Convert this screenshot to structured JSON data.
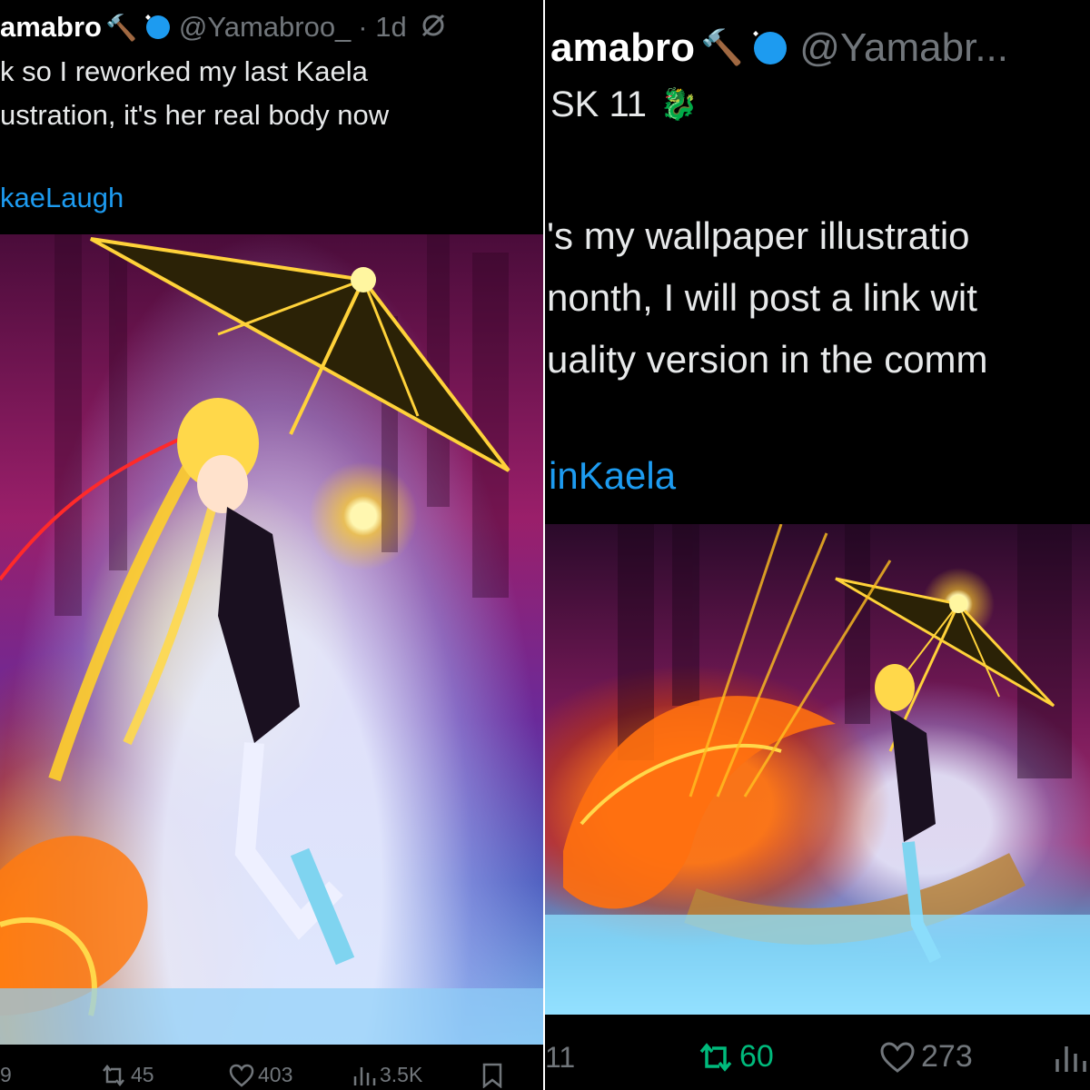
{
  "left": {
    "name": "amabro",
    "emoji": "🔨",
    "handle": "@Yamabroo_",
    "time": "· 1d",
    "text_lines": [
      "k so I reworked my last Kaela",
      "ustration, it's her real body now"
    ],
    "hashtag": "kaeLaugh",
    "actions": {
      "replies": "9",
      "reposts": "45",
      "likes": "403",
      "views": "3.5K"
    }
  },
  "right": {
    "name": "amabro",
    "emoji": "🔨",
    "handle": "@Yamabr...",
    "subtitle": "SK 11",
    "subtitle_emoji": "🐉",
    "text_lines": [
      "'s my wallpaper illustratio",
      "nonth, I will post a link wit",
      "uality version in the comm"
    ],
    "hashtag": "inKaela",
    "actions": {
      "replies": "11",
      "reposts": "60",
      "likes": "273"
    }
  },
  "colors": {
    "background": "#000000",
    "text": "#e7e9ea",
    "muted": "#71767b",
    "link": "#1d9bf0",
    "repost_active": "#00ba7c",
    "verified": "#1d9bf0"
  },
  "icons": [
    "verified-badge-icon",
    "hammer-emoji",
    "dragon-emoji",
    "mute-icon",
    "reply-icon",
    "repost-icon",
    "like-icon",
    "views-icon",
    "bookmark-icon"
  ]
}
